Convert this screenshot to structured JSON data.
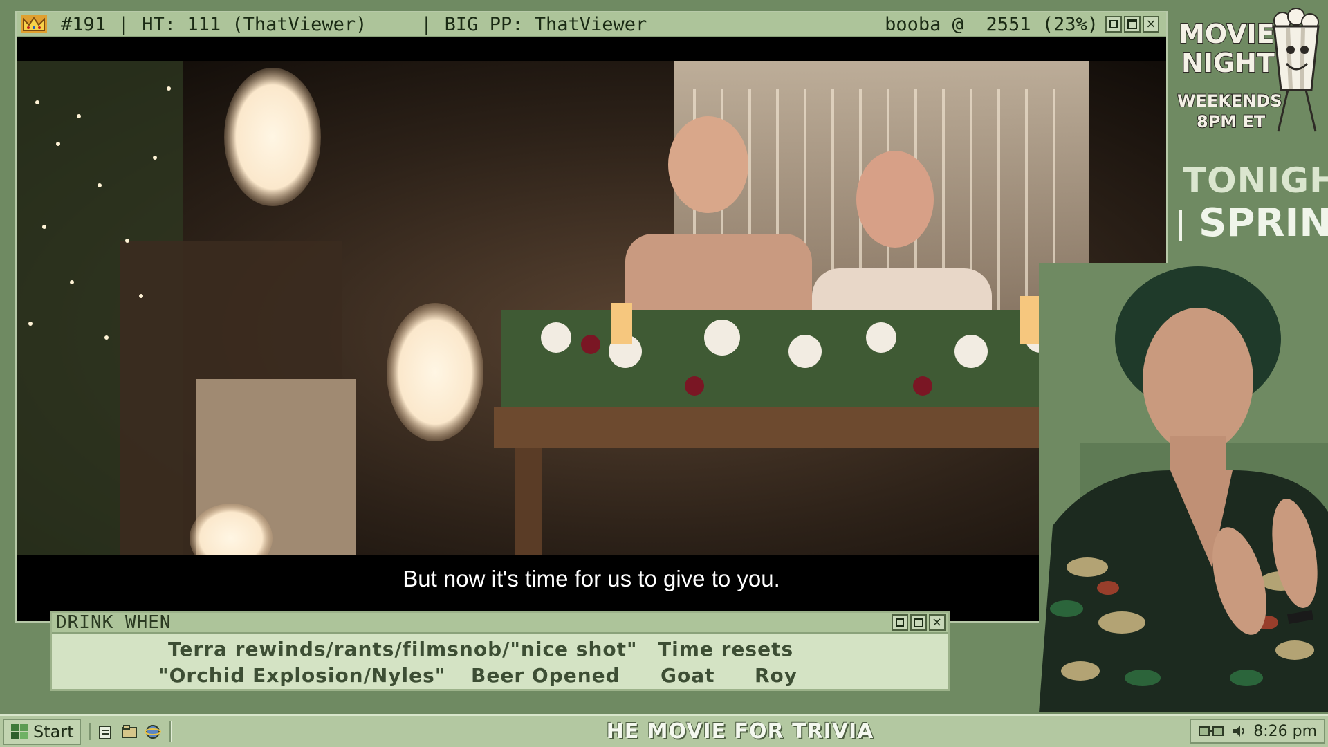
{
  "window": {
    "id_label": "#191",
    "ht_label": "HT: 111 (ThatViewer)",
    "bigpp_label": "BIG PP: ThatViewer",
    "goal_label": "booba @  2551 (23%)",
    "btn_min": "",
    "btn_max": "",
    "btn_close": "×"
  },
  "video": {
    "subtitle": "But now it's time for us to give to you."
  },
  "drink_when": {
    "title": "DRINK WHEN",
    "items": [
      "Terra rewinds/rants/filmsnob/\"nice shot\"",
      "Time resets",
      "\"Orchid Explosion/Nyles\"",
      "Beer Opened",
      "Goat",
      "Roy"
    ]
  },
  "promo": {
    "logo_line1": "MOVIE",
    "logo_line2": "NIGHT",
    "logo_line3": "WEEKENDS",
    "logo_line4": "8PM ET",
    "tonight_label": "TONIGHT:",
    "tonight_movie": "SPRING"
  },
  "taskbar": {
    "start_label": "Start",
    "ticker": "HE MOVIE FOR TRIVIA",
    "clock": "8:26 pm"
  },
  "colors": {
    "background": "#6f8a62",
    "titlebar": "#adc49a",
    "panel": "#d4e3c4"
  }
}
